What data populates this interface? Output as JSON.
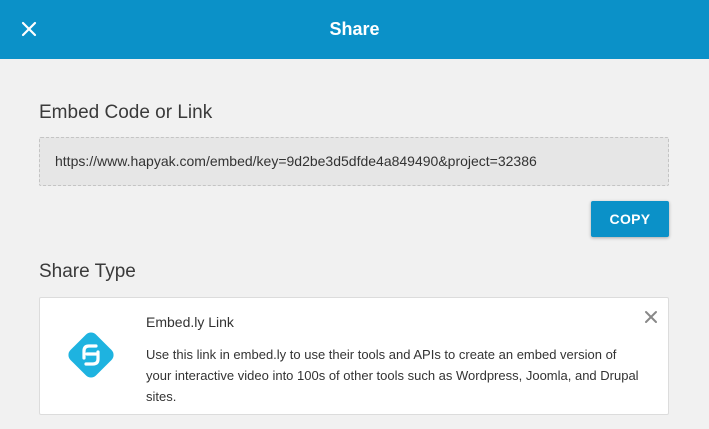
{
  "header": {
    "title": "Share",
    "close_icon": "close-icon",
    "background_color": "#0b91c8"
  },
  "embed": {
    "heading": "Embed Code or Link",
    "url": "https://www.hapyak.com/embed/key=9d2be3d5dfde4a849490&project=32386",
    "copy_label": "COPY"
  },
  "share_type": {
    "heading": "Share Type",
    "card": {
      "logo_icon": "embedly-logo-icon",
      "title": "Embed.ly Link",
      "description": "Use this link in embed.ly to use their tools and APIs to create an embed version of your interactive video into 100s of other tools such as Wordpress, Joomla, and Drupal sites.",
      "close_icon": "close-icon",
      "accent_color": "#1eb3e0"
    }
  }
}
